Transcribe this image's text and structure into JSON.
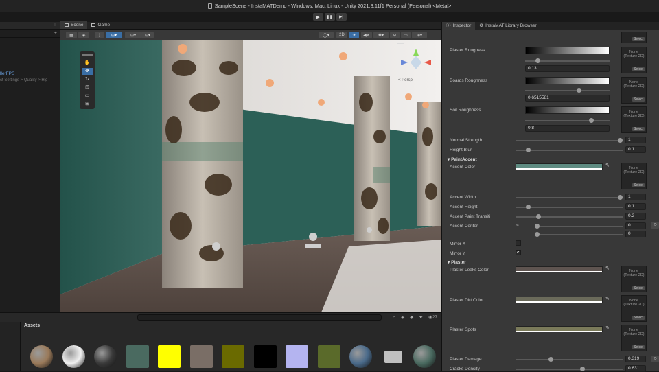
{
  "window": {
    "title": "SampleScene - InstaMATDemo - Windows, Mac, Linux - Unity 2021.3.11f1 Personal (Personal) <Metal>"
  },
  "playbar": {
    "play": "▶",
    "pause": "❚❚",
    "step": "▶|"
  },
  "hierarchy": {
    "item_label": "llerFPS",
    "item_sub": "ct Settings > Quality > Hig",
    "add_icon": "+"
  },
  "scene": {
    "tabs": [
      {
        "label": "Scene"
      },
      {
        "label": "Game"
      }
    ],
    "tool_2d": "2D",
    "persp_label": "< Persp"
  },
  "project": {
    "section_label": "Assets",
    "count": "27"
  },
  "assets": [
    {
      "name": "sphere-brown",
      "color": "#9a7a5a"
    },
    {
      "name": "sphere-white",
      "color": "#f0f0f0"
    },
    {
      "name": "sphere-dark",
      "color": "#3a3a3a"
    },
    {
      "name": "teal",
      "color": "#4a6a60"
    },
    {
      "name": "yellow",
      "color": "#ffff00"
    },
    {
      "name": "taupe",
      "color": "#7a6e66"
    },
    {
      "name": "olive",
      "color": "#6a6a00"
    },
    {
      "name": "black",
      "color": "#000000"
    },
    {
      "name": "lavender",
      "color": "#b4b4f0"
    },
    {
      "name": "moss",
      "color": "#5a6a2a"
    },
    {
      "name": "sphere-blue",
      "color": "#4a6a8a"
    },
    {
      "name": "folder",
      "color": "#c0c0c0"
    },
    {
      "name": "sphere-green",
      "color": "#4a6a60"
    }
  ],
  "inspector": {
    "tabs": [
      {
        "label": "Inspector"
      },
      {
        "label": "InstaMAT Library Browser"
      }
    ],
    "tex_none": "None",
    "tex_type": "(Texture 2D)",
    "tex_select": "Select",
    "plaster_roughness": {
      "label": "Plaster Rougness",
      "value": "0.13",
      "level": 0.13
    },
    "boards_roughness": {
      "label": "Boards Roughness",
      "value": "0.6515581",
      "level": 0.65
    },
    "soil_roughness": {
      "label": "Soil Roughness",
      "value": "0.8",
      "level": 0.8
    },
    "normal_strength": {
      "label": "Normal Strength",
      "value": "1",
      "level": 1
    },
    "height_blur": {
      "label": "Height Blur",
      "value": "0.1",
      "level": 0.1
    },
    "paint_accent_section": "PaintAccent",
    "accent_color": {
      "label": "Accent Color",
      "color": "#5f8c82"
    },
    "accent_width": {
      "label": "Accent Width",
      "value": "1",
      "level": 1
    },
    "accent_height": {
      "label": "Accent Height",
      "value": "0.1",
      "level": 0.1
    },
    "accent_paint_transition": {
      "label": "Accent Paint Transiti",
      "value": "0.2",
      "level": 0.2
    },
    "accent_center": {
      "label": "Accent Center",
      "value_x": "0",
      "value_y": "0",
      "level": 0
    },
    "mirror_x": {
      "label": "Mirror X",
      "checked": false
    },
    "mirror_y": {
      "label": "Mirror Y",
      "checked": true,
      "mark": "✔"
    },
    "plaster_section": "Plaster",
    "plaster_leaks_color": {
      "label": "Plaster Leaks Color",
      "color": "#5e5450"
    },
    "plaster_dirt_color": {
      "label": "Plaster Dirt Color",
      "color": "#6a6a5a"
    },
    "plaster_spots": {
      "label": "Plaster Spots",
      "color": "#7a7a5a"
    },
    "plaster_damage": {
      "label": "Plaster Damage",
      "value": "0.319",
      "level": 0.319
    },
    "cracks_density": {
      "label": "Cracks Density",
      "value": "0.631",
      "level": 0.631
    }
  }
}
